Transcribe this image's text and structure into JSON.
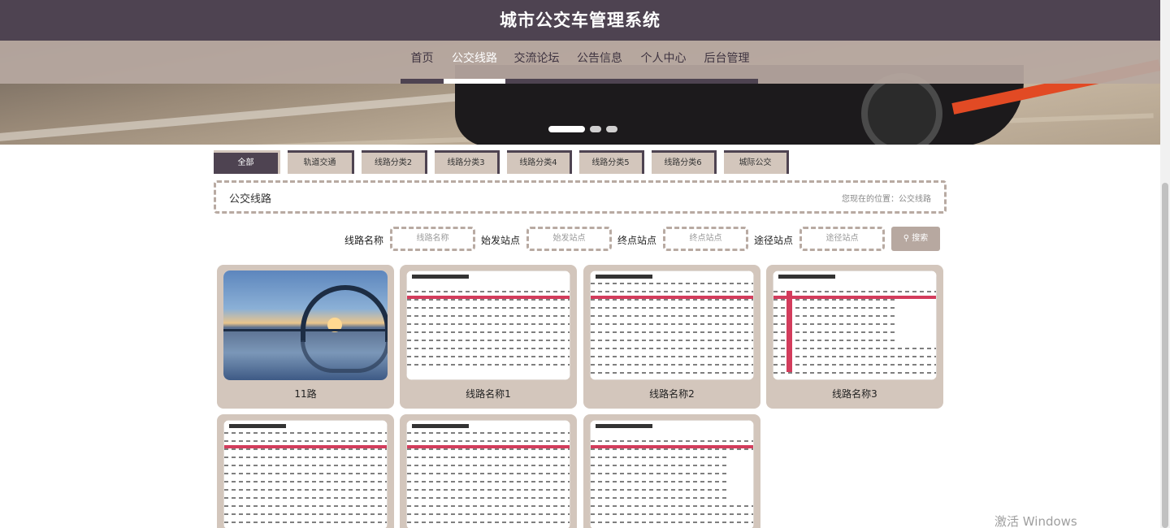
{
  "header": {
    "title": "城市公交车管理系统"
  },
  "nav": {
    "items": [
      {
        "label": "首页"
      },
      {
        "label": "公交线路"
      },
      {
        "label": "交流论坛"
      },
      {
        "label": "公告信息"
      },
      {
        "label": "个人中心"
      },
      {
        "label": "后台管理"
      }
    ],
    "active_index": 1
  },
  "carousel": {
    "slide_count": 3,
    "active_slide": 1
  },
  "category_tabs": [
    {
      "label": "全部"
    },
    {
      "label": "轨道交通"
    },
    {
      "label": "线路分类2"
    },
    {
      "label": "线路分类3"
    },
    {
      "label": "线路分类4"
    },
    {
      "label": "线路分类5"
    },
    {
      "label": "线路分类6"
    },
    {
      "label": "城际公交"
    }
  ],
  "breadcrumb": {
    "title": "公交线路",
    "location": "您现在的位置：公交线路"
  },
  "search": {
    "fields": [
      {
        "label": "线路名称",
        "placeholder": "线路名称"
      },
      {
        "label": "始发站点",
        "placeholder": "始发站点"
      },
      {
        "label": "终点站点",
        "placeholder": "终点站点"
      },
      {
        "label": "途径站点",
        "placeholder": "途径站点"
      }
    ],
    "button_label": "搜索"
  },
  "routes": [
    {
      "name": "11路"
    },
    {
      "name": "线路名称1"
    },
    {
      "name": "线路名称2"
    },
    {
      "name": "线路名称3"
    },
    {
      "name": ""
    },
    {
      "name": ""
    },
    {
      "name": ""
    }
  ],
  "os_watermark": "激活 Windows",
  "colors": {
    "primary": "#4e4351",
    "secondary": "#b7a8a0",
    "card_bg": "#d3c6bc",
    "route_red": "#d33c5c"
  }
}
